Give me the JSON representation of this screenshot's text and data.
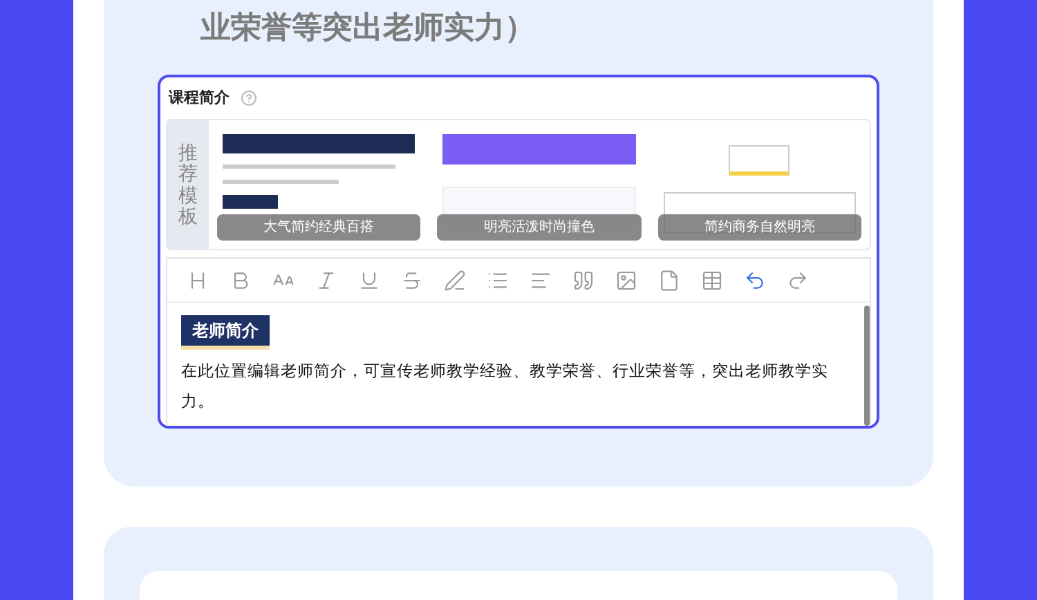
{
  "section_title": "业荣誉等突出老师实力）",
  "editor": {
    "label": "课程简介",
    "templates_label": "推荐模板",
    "templates": [
      {
        "caption": "大气简约经典百搭",
        "kind": "dark"
      },
      {
        "caption": "明亮活泼时尚撞色",
        "kind": "purple"
      },
      {
        "caption": "简约商务自然明亮",
        "kind": "light"
      }
    ],
    "toolbar": [
      {
        "kind": "heading",
        "active": false
      },
      {
        "kind": "bold",
        "active": false
      },
      {
        "kind": "font-size",
        "active": false
      },
      {
        "kind": "italic",
        "active": false
      },
      {
        "kind": "underline",
        "active": false
      },
      {
        "kind": "strikethrough",
        "active": false
      },
      {
        "kind": "pen",
        "active": false
      },
      {
        "kind": "list",
        "active": false
      },
      {
        "kind": "align",
        "active": false
      },
      {
        "kind": "quote",
        "active": false
      },
      {
        "kind": "image",
        "active": false
      },
      {
        "kind": "file",
        "active": false
      },
      {
        "kind": "table",
        "active": false
      },
      {
        "kind": "undo",
        "active": true
      },
      {
        "kind": "redo",
        "active": false
      }
    ],
    "content_heading": "老师简介",
    "content_text": "在此位置编辑老师简介，可宣传老师教学经验、教学荣誉、行业荣誉等，突出老师教学实力。"
  }
}
